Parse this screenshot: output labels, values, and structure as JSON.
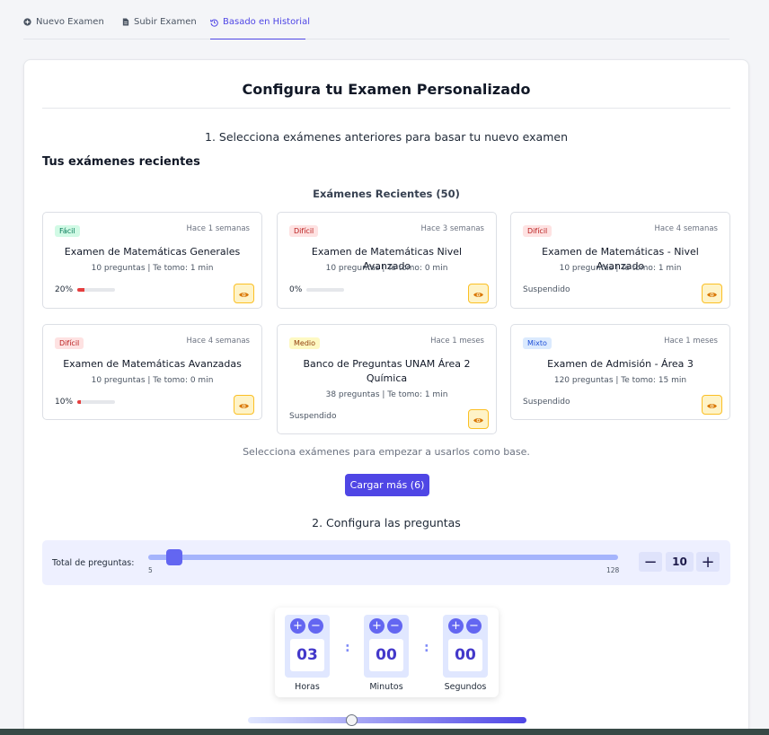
{
  "tabs": [
    {
      "label": "Nuevo Examen",
      "icon": "plus-circle-icon"
    },
    {
      "label": "Subir Examen",
      "icon": "file-icon"
    },
    {
      "label": "Basado en Historial",
      "icon": "history-icon",
      "active": true
    }
  ],
  "main": {
    "title": "Configura tu Examen Personalizado",
    "step1": "1. Selecciona exámenes anteriores para basar tu nuevo examen",
    "recent_heading": "Tus exámenes recientes",
    "recent_count_label": "Exámenes Recientes (50)",
    "hint": "Selecciona exámenes para empezar a usarlos como base.",
    "load_more": "Cargar más (6)",
    "step2": "2. Configura las preguntas"
  },
  "exams": [
    {
      "difficulty": "Fácil",
      "ago": "Hace 1 semanas",
      "title": "Examen de Matemáticas Generales",
      "meta": "10 preguntas | Te tomo: 1 min",
      "progress_label": "20%",
      "progress": 0.2
    },
    {
      "difficulty": "Difícil",
      "ago": "Hace 3 semanas",
      "title": "Examen de Matemáticas Nivel Avanzado",
      "meta": "10 preguntas | Te tomo: 0 min",
      "progress_label": "0%",
      "progress": 0
    },
    {
      "difficulty": "Difícil",
      "ago": "Hace 4 semanas",
      "title": "Examen de Matemáticas - Nivel Avanzado",
      "meta": "10 preguntas | Te tomo: 1 min",
      "status": "Suspendido"
    },
    {
      "difficulty": "Difícil",
      "ago": "Hace 4 semanas",
      "title": "Examen de Matemáticas Avanzadas",
      "meta": "10 preguntas | Te tomo: 0 min",
      "progress_label": "10%",
      "progress": 0.1
    },
    {
      "difficulty": "Medio",
      "ago": "Hace 1 meses",
      "title": "Banco de Preguntas UNAM Área 2 Química",
      "meta": "38 preguntas | Te tomo: 1 min",
      "status": "Suspendido"
    },
    {
      "difficulty": "Mixto",
      "ago": "Hace 1 meses",
      "title": "Examen de Admisión - Área 3",
      "meta": "120 preguntas | Te tomo: 15 min",
      "status": "Suspendido"
    }
  ],
  "questions": {
    "label": "Total de preguntas:",
    "min": "5",
    "max": "128",
    "value": "10",
    "minus": "−",
    "plus": "+"
  },
  "timer": {
    "hours": "03",
    "minutes": "00",
    "seconds": "00",
    "hours_label": "Horas",
    "minutes_label": "Minutos",
    "seconds_label": "Segundos",
    "separator": ":",
    "plus": "+",
    "minus": "−"
  },
  "colors": {
    "accent": "#4f46e5",
    "progress": "#e53e3e"
  }
}
